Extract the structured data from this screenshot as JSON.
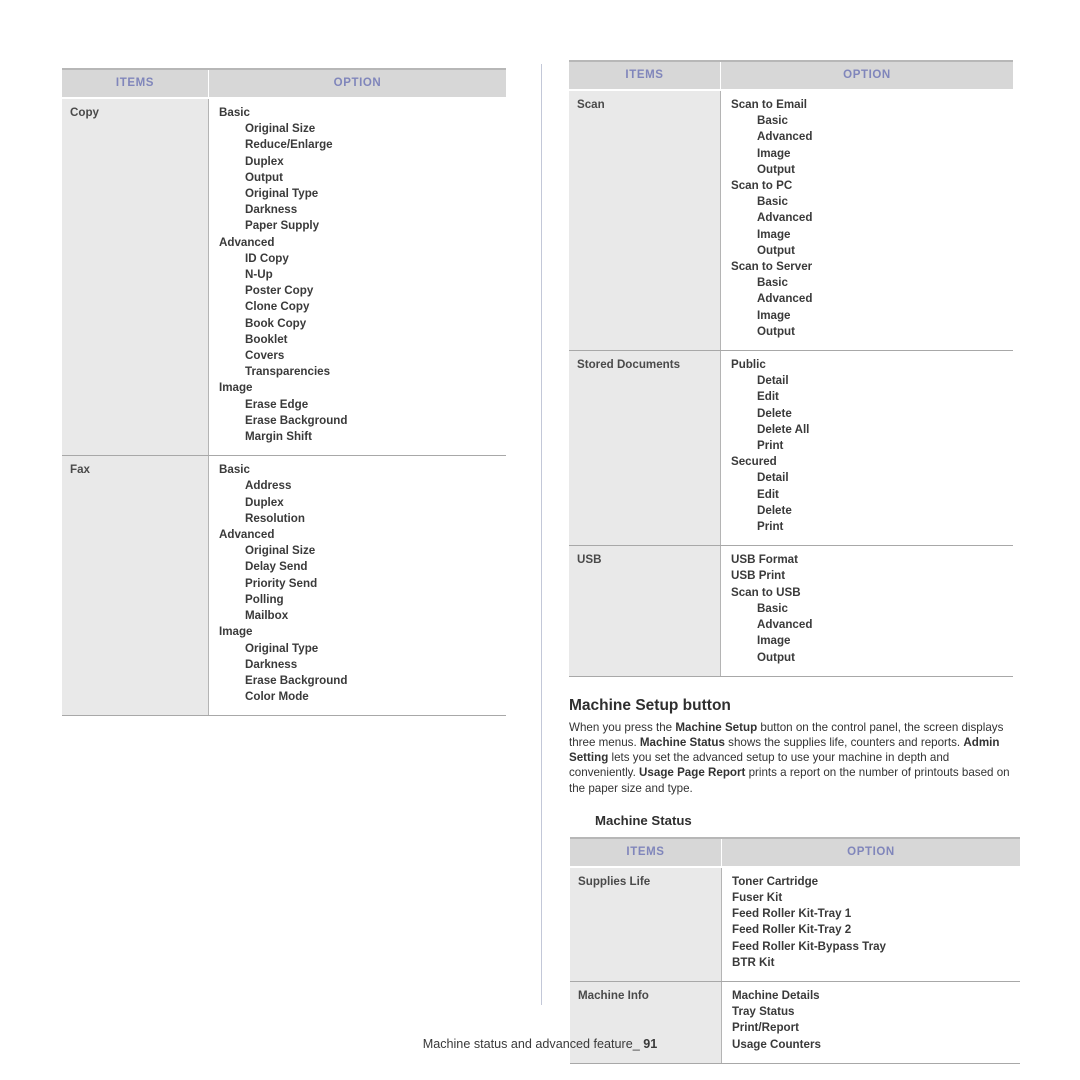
{
  "table_headers": {
    "items": "ITEMS",
    "option": "OPTION"
  },
  "colors": {
    "header_bg": "#d7d7d7",
    "header_text": "#8086bb",
    "items_cell_bg": "#e9e9e9",
    "rule": "#a8a8a8",
    "divider": "#c3c8d8"
  },
  "left_table": {
    "rows": [
      {
        "item": "Copy",
        "options": [
          {
            "label": "Basic",
            "level": 0
          },
          {
            "label": "Original Size",
            "level": 1
          },
          {
            "label": "Reduce/Enlarge",
            "level": 1
          },
          {
            "label": "Duplex",
            "level": 1
          },
          {
            "label": "Output",
            "level": 1
          },
          {
            "label": "Original Type",
            "level": 1
          },
          {
            "label": "Darkness",
            "level": 1
          },
          {
            "label": "Paper Supply",
            "level": 1
          },
          {
            "label": "Advanced",
            "level": 0
          },
          {
            "label": "ID Copy",
            "level": 1
          },
          {
            "label": "N-Up",
            "level": 1
          },
          {
            "label": "Poster Copy",
            "level": 1
          },
          {
            "label": "Clone Copy",
            "level": 1
          },
          {
            "label": "Book Copy",
            "level": 1
          },
          {
            "label": "Booklet",
            "level": 1
          },
          {
            "label": "Covers",
            "level": 1
          },
          {
            "label": "Transparencies",
            "level": 1
          },
          {
            "label": "Image",
            "level": 0
          },
          {
            "label": "Erase Edge",
            "level": 1
          },
          {
            "label": "Erase Background",
            "level": 1
          },
          {
            "label": "Margin Shift",
            "level": 1
          }
        ]
      },
      {
        "item": "Fax",
        "options": [
          {
            "label": "Basic",
            "level": 0
          },
          {
            "label": "Address",
            "level": 1
          },
          {
            "label": "Duplex",
            "level": 1
          },
          {
            "label": "Resolution",
            "level": 1
          },
          {
            "label": "Advanced",
            "level": 0
          },
          {
            "label": "Original Size",
            "level": 1
          },
          {
            "label": "Delay Send",
            "level": 1
          },
          {
            "label": "Priority Send",
            "level": 1
          },
          {
            "label": "Polling",
            "level": 1
          },
          {
            "label": "Mailbox",
            "level": 1
          },
          {
            "label": "Image",
            "level": 0
          },
          {
            "label": "Original Type",
            "level": 1
          },
          {
            "label": "Darkness",
            "level": 1
          },
          {
            "label": "Erase Background",
            "level": 1
          },
          {
            "label": "Color Mode",
            "level": 1
          }
        ]
      }
    ]
  },
  "right_table": {
    "rows": [
      {
        "item": "Scan",
        "options": [
          {
            "label": "Scan to Email",
            "level": 0
          },
          {
            "label": "Basic",
            "level": 1
          },
          {
            "label": "Advanced",
            "level": 1
          },
          {
            "label": "Image",
            "level": 1
          },
          {
            "label": "Output",
            "level": 1
          },
          {
            "label": "Scan to PC",
            "level": 0
          },
          {
            "label": "Basic",
            "level": 1
          },
          {
            "label": "Advanced",
            "level": 1
          },
          {
            "label": "Image",
            "level": 1
          },
          {
            "label": "Output",
            "level": 1
          },
          {
            "label": "Scan to Server",
            "level": 0
          },
          {
            "label": "Basic",
            "level": 1
          },
          {
            "label": "Advanced",
            "level": 1
          },
          {
            "label": "Image",
            "level": 1
          },
          {
            "label": "Output",
            "level": 1
          }
        ]
      },
      {
        "item": "Stored Documents",
        "options": [
          {
            "label": "Public",
            "level": 0
          },
          {
            "label": "Detail",
            "level": 1
          },
          {
            "label": "Edit",
            "level": 1
          },
          {
            "label": "Delete",
            "level": 1
          },
          {
            "label": "Delete All",
            "level": 1
          },
          {
            "label": "Print",
            "level": 1
          },
          {
            "label": "Secured",
            "level": 0
          },
          {
            "label": "Detail",
            "level": 1
          },
          {
            "label": "Edit",
            "level": 1
          },
          {
            "label": "Delete",
            "level": 1
          },
          {
            "label": "Print",
            "level": 1
          }
        ]
      },
      {
        "item": "USB",
        "options": [
          {
            "label": "USB Format",
            "level": 0
          },
          {
            "label": "USB Print",
            "level": 0
          },
          {
            "label": "Scan to USB",
            "level": 0
          },
          {
            "label": "Basic",
            "level": 1
          },
          {
            "label": "Advanced",
            "level": 1
          },
          {
            "label": "Image",
            "level": 1
          },
          {
            "label": "Output",
            "level": 1
          }
        ]
      }
    ]
  },
  "machine_setup": {
    "heading": "Machine Setup button",
    "paragraph_parts": [
      {
        "text": "When you press the  ",
        "bold": false
      },
      {
        "text": "Machine Setup",
        "bold": true
      },
      {
        "text": " button on the control panel, the screen displays three menus. ",
        "bold": false
      },
      {
        "text": "Machine Status",
        "bold": true
      },
      {
        "text": " shows the supplies life, counters and reports. ",
        "bold": false
      },
      {
        "text": "Admin Setting",
        "bold": true
      },
      {
        "text": " lets you set the advanced setup to use your machine in depth and conveniently. ",
        "bold": false
      },
      {
        "text": "Usage Page Report",
        "bold": true
      },
      {
        "text": " prints a report on the number of printouts based on the paper size and type.",
        "bold": false
      }
    ],
    "subheading": "Machine Status"
  },
  "status_table": {
    "rows": [
      {
        "item": "Supplies Life",
        "options": [
          {
            "label": "Toner Cartridge",
            "level": 0
          },
          {
            "label": "Fuser Kit",
            "level": 0
          },
          {
            "label": "Feed Roller Kit-Tray 1",
            "level": 0
          },
          {
            "label": "Feed Roller Kit-Tray 2",
            "level": 0
          },
          {
            "label": "Feed Roller Kit-Bypass Tray",
            "level": 0
          },
          {
            "label": "BTR Kit",
            "level": 0
          }
        ]
      },
      {
        "item": "Machine Info",
        "options": [
          {
            "label": "Machine Details",
            "level": 0
          },
          {
            "label": "Tray Status",
            "level": 0
          },
          {
            "label": "Print/Report",
            "level": 0
          },
          {
            "label": "Usage Counters",
            "level": 0
          }
        ]
      }
    ]
  },
  "footer": {
    "text": "Machine status and advanced feature_",
    "page_number": "91"
  }
}
